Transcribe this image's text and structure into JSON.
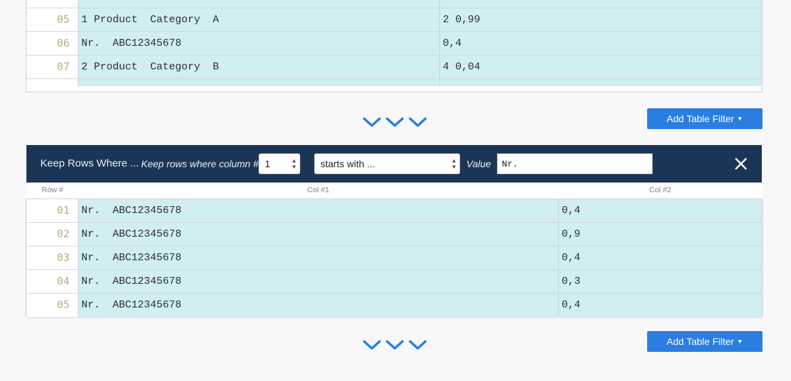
{
  "top_table": {
    "rows": [
      {
        "num": "05",
        "col1": "1 Product  Category  A",
        "col2": "2 0,99"
      },
      {
        "num": "06",
        "col1": "Nr.  ABC12345678",
        "col2": "0,4"
      },
      {
        "num": "07",
        "col1": "2 Product  Category  B",
        "col2": "4 0,04"
      }
    ]
  },
  "add_filter_button": {
    "label": "Add Table Filter"
  },
  "filter_bar": {
    "title": "Keep Rows Where ...",
    "column_label": "Keep rows where column #",
    "column_value": "1",
    "operator_value": "starts with ...",
    "value_label": "Value",
    "value_input": "Nr."
  },
  "bottom_table": {
    "headers": {
      "row": "Row #",
      "col1": "Col #1",
      "col2": "Col #2"
    },
    "rows": [
      {
        "num": "01",
        "col1": "Nr.  ABC12345678",
        "col2": "0,4"
      },
      {
        "num": "02",
        "col1": "Nr.  ABC12345678",
        "col2": "0,9"
      },
      {
        "num": "03",
        "col1": "Nr.  ABC12345678",
        "col2": "0,4"
      },
      {
        "num": "04",
        "col1": "Nr.  ABC12345678",
        "col2": "0,3"
      },
      {
        "num": "05",
        "col1": "Nr.  ABC12345678",
        "col2": "0,4"
      }
    ]
  },
  "colors": {
    "accent": "#2a7de1",
    "filter_bar": "#1b3556",
    "cell": "#d1eef1",
    "row_number": "#b6ad84"
  },
  "icons": {
    "expand": "chevron-down-icon",
    "close": "close-icon"
  }
}
